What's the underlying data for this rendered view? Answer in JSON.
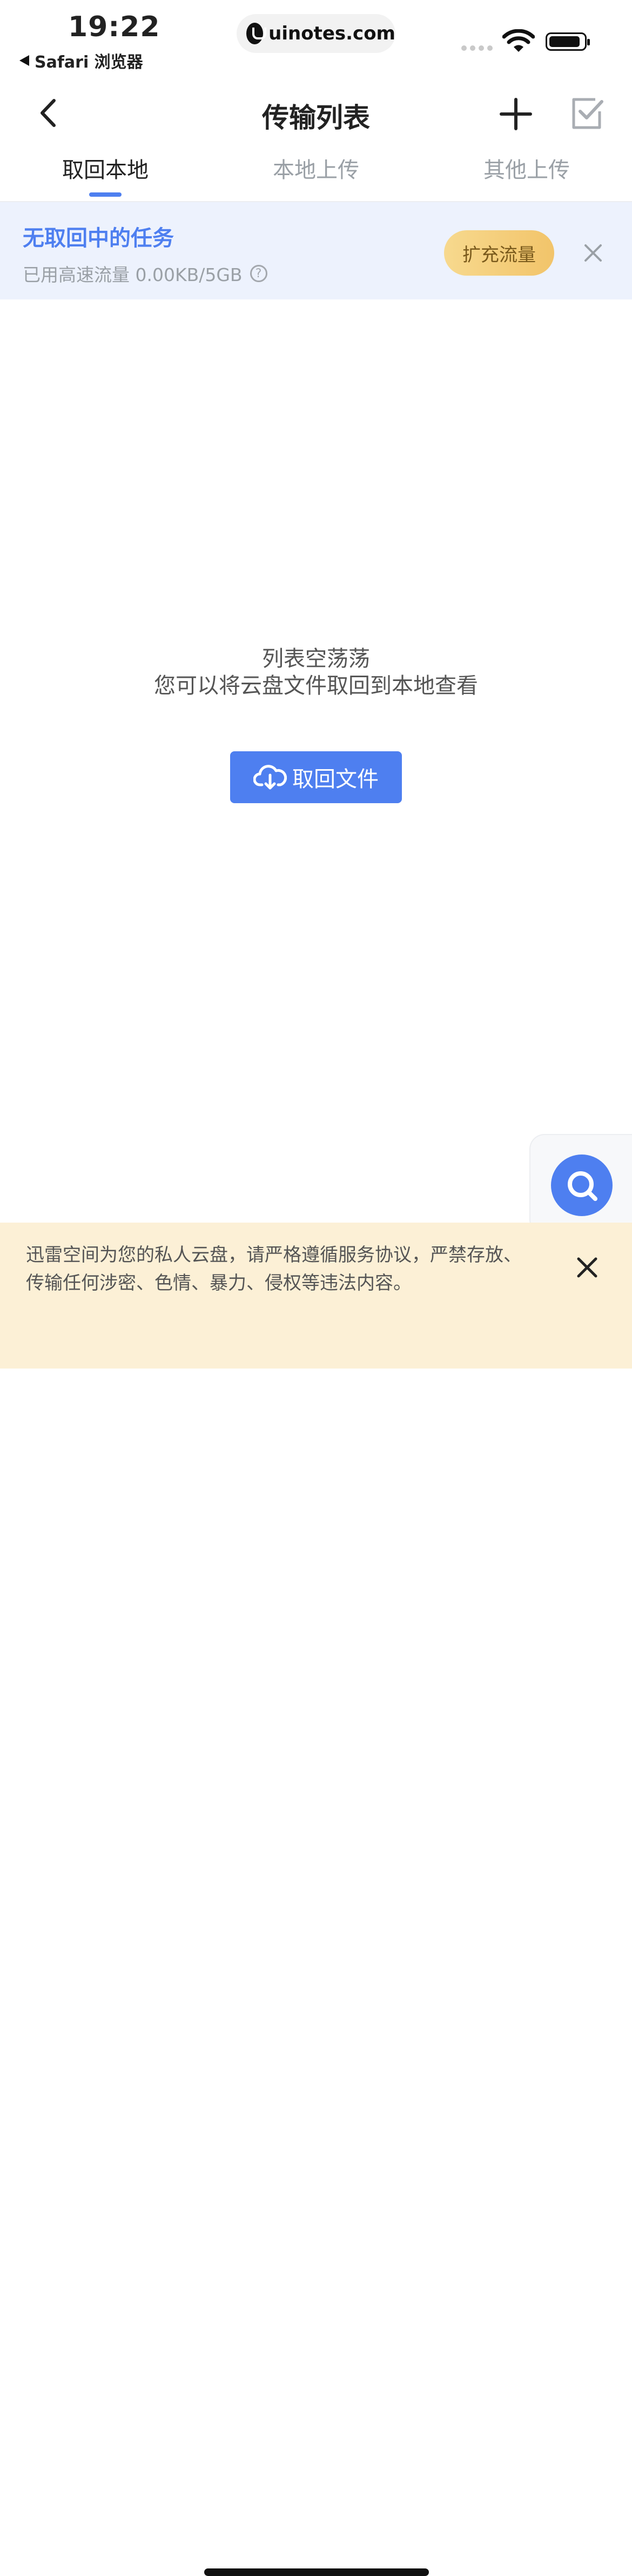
{
  "status_bar": {
    "time": "19:22",
    "back_app": "Safari 浏览器",
    "url": "uinotes.com"
  },
  "nav": {
    "title": "传输列表",
    "back_icon": "chevron-left-icon",
    "add_icon": "plus-icon",
    "select_icon": "checkbox-check-icon"
  },
  "tabs": [
    {
      "label": "取回本地",
      "active": true
    },
    {
      "label": "本地上传",
      "active": false
    },
    {
      "label": "其他上传",
      "active": false
    }
  ],
  "banner": {
    "title": "无取回中的任务",
    "subtitle": "已用高速流量 0.00KB/5GB",
    "help_glyph": "?",
    "expand_label": "扩充流量"
  },
  "empty_state": {
    "title": "列表空荡荡",
    "description": "您可以将云盘文件取回到本地查看",
    "button_label": "取回文件"
  },
  "notice": {
    "text": "迅雷空间为您的私人云盘，请严格遵循服务协议，严禁存放、传输任何涉密、色情、暴力、侵权等违法内容。"
  },
  "colors": {
    "accent": "#4e7ff0",
    "banner_bg": "#edf2fd",
    "notice_bg": "#fcf0d6",
    "expand_button": "#f2c46a"
  }
}
